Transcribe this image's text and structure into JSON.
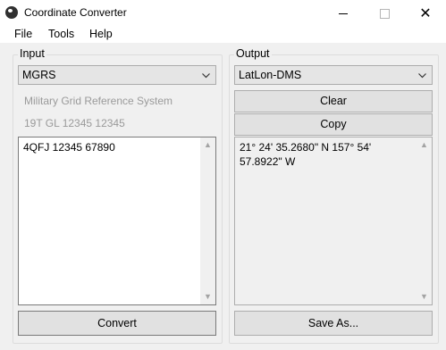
{
  "window": {
    "title": "Coordinate Converter",
    "close_glyph": "✕"
  },
  "menu": {
    "file": "File",
    "tools": "Tools",
    "help": "Help"
  },
  "input": {
    "group_label": "Input",
    "format_selected": "MGRS",
    "format_description": "Military Grid Reference System",
    "format_example": "19T GL 12345 12345",
    "text": "4QFJ 12345 67890",
    "convert_label": "Convert"
  },
  "output": {
    "group_label": "Output",
    "format_selected": "LatLon-DMS",
    "clear_label": "Clear",
    "copy_label": "Copy",
    "text": "21° 24' 35.2680\" N 157° 54' 57.8922\" W",
    "save_as_label": "Save As..."
  },
  "colors": {
    "window_bg": "#f0f0f0",
    "button_bg": "#e1e1e1",
    "field_bg": "#ffffff"
  },
  "icons": {
    "app": "app-icon",
    "minimize": "minimize-icon",
    "maximize": "maximize-icon",
    "close": "close-icon",
    "dropdown": "chevron-down-icon",
    "scroll_up": "scroll-up-icon",
    "scroll_down": "scroll-down-icon"
  }
}
